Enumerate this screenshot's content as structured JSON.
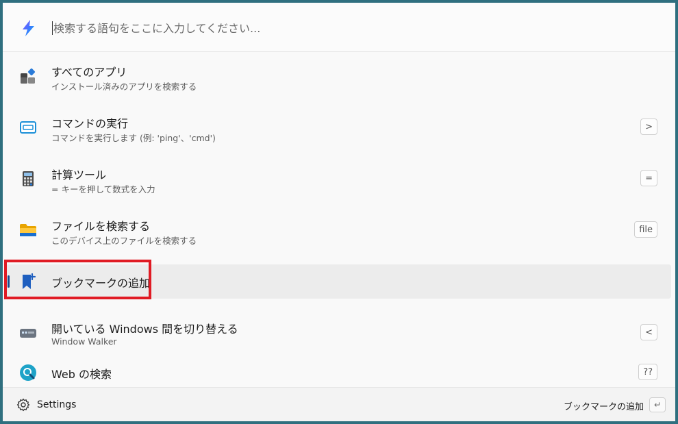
{
  "search": {
    "placeholder": "検索する語句をここに入力してください..."
  },
  "items": [
    {
      "title": "すべてのアプリ",
      "subtitle": "インストール済みのアプリを検索する",
      "shortcut": ""
    },
    {
      "title": "コマンドの実行",
      "subtitle": "コマンドを実行します (例: 'ping'、'cmd')",
      "shortcut": ">"
    },
    {
      "title": "計算ツール",
      "subtitle": "= キーを押して数式を入力",
      "shortcut": "="
    },
    {
      "title": "ファイルを検索する",
      "subtitle": "このデバイス上のファイルを検索する",
      "shortcut": "file"
    },
    {
      "title": "ブックマークの追加",
      "subtitle": "",
      "shortcut": ""
    },
    {
      "title": "開いている Windows 間を切り替える",
      "subtitle": "Window Walker",
      "shortcut": "<"
    },
    {
      "title": "Web の検索",
      "subtitle": "",
      "shortcut": "??"
    }
  ],
  "footer": {
    "settings_label": "Settings",
    "primary_action": "ブックマークの追加",
    "enter_key": "↵"
  },
  "icons": {
    "app_logo": "lightning-bolt-icon",
    "apps": "all-apps-icon",
    "run": "terminal-window-icon",
    "calc": "calculator-icon",
    "files": "folder-icon",
    "bookmark": "bookmark-add-icon",
    "windows": "window-switch-icon",
    "web": "web-search-icon",
    "settings": "gear-icon"
  },
  "colors": {
    "accent": "#1a4d8f",
    "highlight": "#e01b24"
  }
}
